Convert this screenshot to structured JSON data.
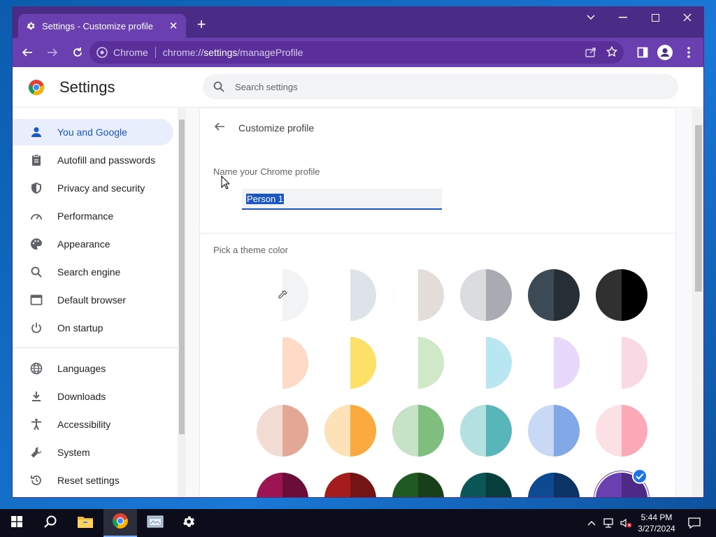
{
  "browser": {
    "tab_title": "Settings - Customize profile",
    "omnibox_site": "Chrome",
    "url_prefix": "chrome://",
    "url_host": "settings",
    "url_path": "/manageProfile",
    "theme_color": "#6a3fb0"
  },
  "header": {
    "title": "Settings",
    "search_placeholder": "Search settings"
  },
  "sidebar": {
    "items": [
      {
        "label": "You and Google",
        "icon": "person-icon"
      },
      {
        "label": "Autofill and passwords",
        "icon": "clipboard-icon"
      },
      {
        "label": "Privacy and security",
        "icon": "shield-icon"
      },
      {
        "label": "Performance",
        "icon": "speedometer-icon"
      },
      {
        "label": "Appearance",
        "icon": "palette-icon"
      },
      {
        "label": "Search engine",
        "icon": "search-icon"
      },
      {
        "label": "Default browser",
        "icon": "browser-window-icon"
      },
      {
        "label": "On startup",
        "icon": "power-icon"
      },
      {
        "label": "Languages",
        "icon": "globe-icon"
      },
      {
        "label": "Downloads",
        "icon": "download-icon"
      },
      {
        "label": "Accessibility",
        "icon": "accessibility-icon"
      },
      {
        "label": "System",
        "icon": "wrench-icon"
      },
      {
        "label": "Reset settings",
        "icon": "history-icon"
      }
    ],
    "active_index": 0
  },
  "main": {
    "title": "Customize profile",
    "name_label": "Name your Chrome profile",
    "profile_name": "Person 1",
    "theme_label": "Pick a theme color",
    "swatches": [
      [
        "#ffffff",
        "#f1f3f4"
      ],
      [
        "#ffffff",
        "#dee3ea"
      ],
      [
        "#ffffff",
        "#e4dcd8"
      ],
      [
        "#dadce0",
        "#a8abb2"
      ],
      [
        "#3c4a55",
        "#262f35"
      ],
      [
        "#303030",
        "#000000"
      ],
      [
        "#ffffff",
        "#fddbc6"
      ],
      [
        "#ffffff",
        "#fde067"
      ],
      [
        "#ffffff",
        "#cfe9c8"
      ],
      [
        "#ffffff",
        "#b8e6f1"
      ],
      [
        "#ffffff",
        "#e8d8fb"
      ],
      [
        "#ffffff",
        "#f9d9e4"
      ],
      [
        "#f3dcd3",
        "#e2a795"
      ],
      [
        "#fde2b8",
        "#fbaa3f"
      ],
      [
        "#c6e3c7",
        "#7fbe7f"
      ],
      [
        "#b3e1e2",
        "#58b6bb"
      ],
      [
        "#c8d9f6",
        "#82a8e6"
      ],
      [
        "#fde0e6",
        "#fba9b6"
      ],
      [
        "#9d1452",
        "#6a0e39"
      ],
      [
        "#a51c1c",
        "#741414"
      ],
      [
        "#1f5a23",
        "#173f1a"
      ],
      [
        "#0b5758",
        "#083d3e"
      ],
      [
        "#0e4a91",
        "#0b3365"
      ],
      [
        "#6a3fb0",
        "#4c2a86"
      ]
    ],
    "selected_swatch": 23
  },
  "taskbar": {
    "time": "5:44 PM",
    "date": "3/27/2024"
  }
}
